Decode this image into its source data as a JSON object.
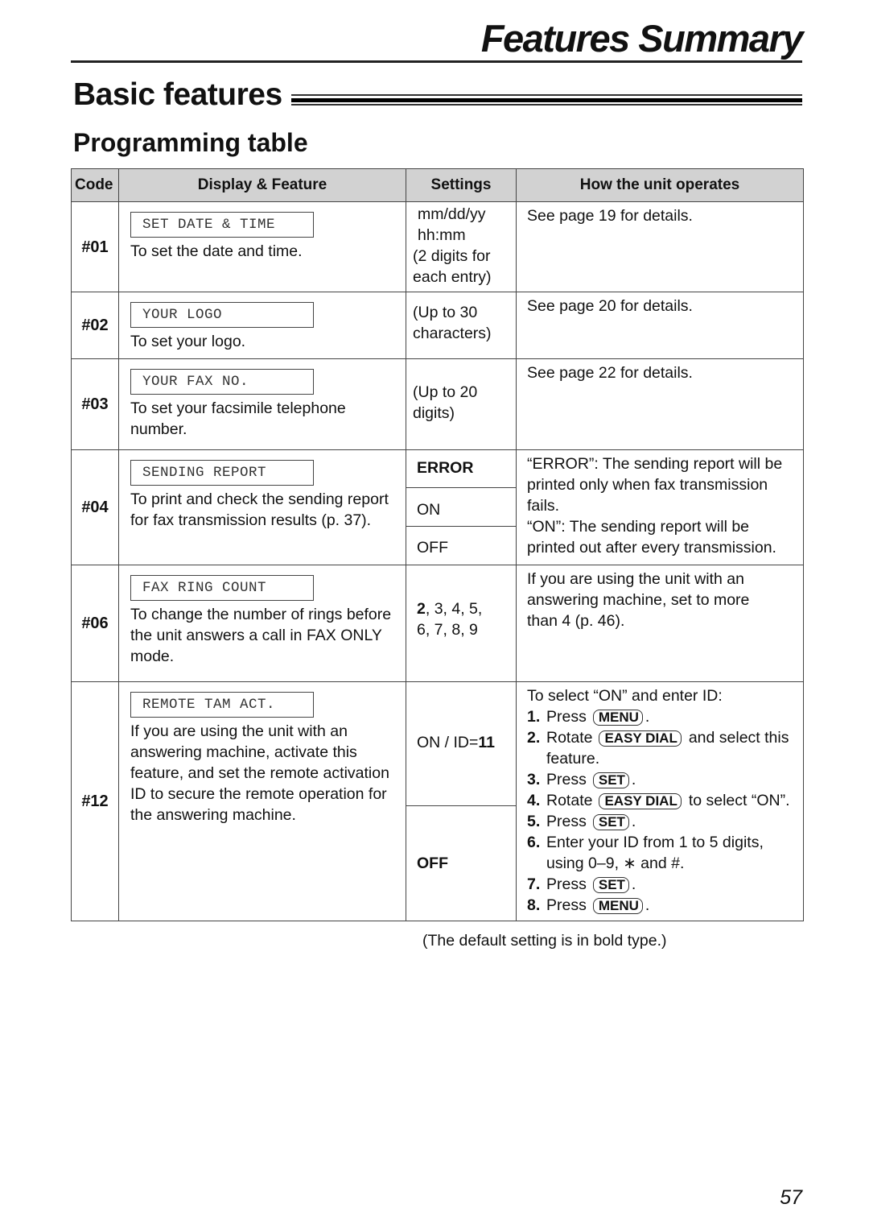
{
  "header": {
    "page_title": "Features Summary",
    "section_title": "Basic features",
    "subsection_title": "Programming table"
  },
  "table": {
    "columns": [
      "Code",
      "Display & Feature",
      "Settings",
      "How the unit operates"
    ],
    "rows": [
      {
        "code": "#01",
        "display": "SET DATE & TIME",
        "feature": "To set the date and time.",
        "settings": [
          "mm/dd/yy",
          "hh:mm",
          "(2 digits for",
          "each entry)"
        ],
        "how": "See page 19 for details."
      },
      {
        "code": "#02",
        "display": "YOUR LOGO",
        "feature": "To set your logo.",
        "settings": [
          "(Up to 30",
          "characters)"
        ],
        "how": "See page 20 for details."
      },
      {
        "code": "#03",
        "display": "YOUR FAX NO.",
        "feature": "To set your facsimile telephone number.",
        "settings": [
          "(Up to 20",
          "digits)"
        ],
        "how": "See page 22 for details."
      },
      {
        "code": "#04",
        "display": "SENDING REPORT",
        "feature": "To print and check the sending report for fax transmission results (p. 37).",
        "settings": [
          "ERROR",
          "ON",
          "OFF"
        ],
        "default": "ERROR",
        "how": "“ERROR”: The sending report will be printed only when fax transmission fails.",
        "how2": "“ON”: The sending report will be printed out after every transmission."
      },
      {
        "code": "#06",
        "display": "FAX RING COUNT",
        "feature": "To change the number of rings before the unit answers a call in FAX ONLY mode.",
        "settings_default": "2",
        "settings_rest": ", 3, 4, 5,",
        "settings_line2": "6, 7, 8, 9",
        "how": "If you are using the unit with an answering machine, set to more than 4 (p. 46)."
      },
      {
        "code": "#12",
        "display": "REMOTE TAM ACT.",
        "feature": "If you are using the unit with an answering machine, activate this feature, and set the remote activation ID to secure the remote operation for the answering machine.",
        "settings_on_prefix": "ON / ID=",
        "settings_on_default_id": "11",
        "settings_off": "OFF",
        "default": "OFF",
        "how_intro": "To select “ON” and enter ID:",
        "steps": [
          {
            "num": "1.",
            "pre": "Press",
            "key": "MENU",
            "post": "."
          },
          {
            "num": "2.",
            "pre": "Rotate",
            "key": "EASY DIAL",
            "post": "and select this feature."
          },
          {
            "num": "3.",
            "pre": "Press",
            "key": "SET",
            "post": "."
          },
          {
            "num": "4.",
            "pre": "Rotate",
            "key": "EASY DIAL",
            "post": "to select “ON”."
          },
          {
            "num": "5.",
            "pre": "Press",
            "key": "SET",
            "post": "."
          },
          {
            "num": "6.",
            "pre": "Enter your ID from 1 to 5 digits, using 0–9, ∗ and #.",
            "key": "",
            "post": ""
          },
          {
            "num": "7.",
            "pre": "Press",
            "key": "SET",
            "post": "."
          },
          {
            "num": "8.",
            "pre": "Press",
            "key": "MENU",
            "post": "."
          }
        ]
      }
    ]
  },
  "footnote": "(The default setting is in bold type.)",
  "page_number": "57"
}
